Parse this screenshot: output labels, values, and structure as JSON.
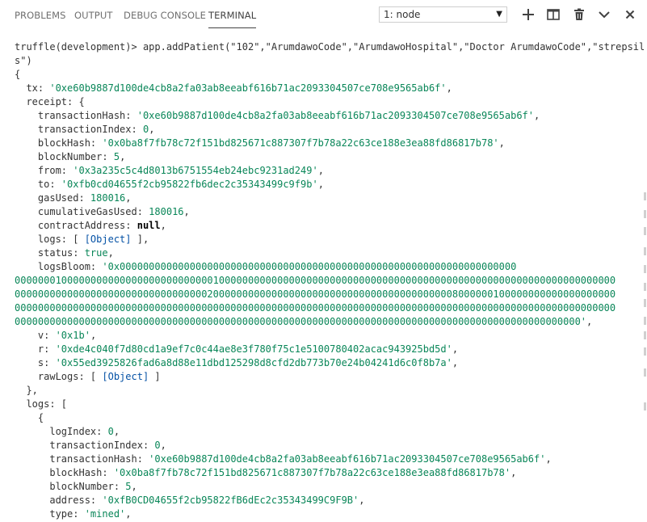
{
  "tabs": [
    {
      "label": "PROBLEMS"
    },
    {
      "label": "OUTPUT"
    },
    {
      "label": "DEBUG CONSOLE"
    },
    {
      "label": "TERMINAL"
    }
  ],
  "terminal_select": {
    "value": "1: node",
    "options": [
      "1: node"
    ]
  },
  "toolbar": {
    "add_icon": "plus-icon",
    "split_icon": "split-pane-icon",
    "delete_icon": "trash-icon",
    "collapse_icon": "chevron-down-icon",
    "close_icon": "close-icon"
  },
  "colors": {
    "string": "#098658",
    "object_link": "#0451a5",
    "text": "#333333"
  },
  "terminal_lines": [
    [
      {
        "t": "truffle(development)> app.addPatient(\"102\",\"ArumdawoCode\",\"ArumdawoHospital\",\"Doctor ArumdawoCode\",\"strepsil"
      }
    ],
    [
      {
        "t": "s\")"
      }
    ],
    [
      {
        "t": "{"
      }
    ],
    [
      {
        "t": "  tx: "
      },
      {
        "t": "'0xe60b9887d100de4cb8a2fa03ab8eeabf616b71ac2093304507ce708e9565ab6f'",
        "c": "s"
      },
      {
        "t": ","
      }
    ],
    [
      {
        "t": "  receipt: {"
      }
    ],
    [
      {
        "t": "    transactionHash: "
      },
      {
        "t": "'0xe60b9887d100de4cb8a2fa03ab8eeabf616b71ac2093304507ce708e9565ab6f'",
        "c": "s"
      },
      {
        "t": ","
      }
    ],
    [
      {
        "t": "    transactionIndex: "
      },
      {
        "t": "0",
        "c": "n"
      },
      {
        "t": ","
      }
    ],
    [
      {
        "t": "    blockHash: "
      },
      {
        "t": "'0x0ba8f7fb78c72f151bd825671c887307f7b78a22c63ce188e3ea88fd86817b78'",
        "c": "s"
      },
      {
        "t": ","
      }
    ],
    [
      {
        "t": "    blockNumber: "
      },
      {
        "t": "5",
        "c": "n"
      },
      {
        "t": ","
      }
    ],
    [
      {
        "t": "    from: "
      },
      {
        "t": "'0x3a235c5c4d8013b6751554eb24ebc9231ad249'",
        "c": "s"
      },
      {
        "t": ","
      }
    ],
    [
      {
        "t": "    to: "
      },
      {
        "t": "'0xfb0cd04655f2cb95822fb6dec2c35343499c9f9b'",
        "c": "s"
      },
      {
        "t": ","
      }
    ],
    [
      {
        "t": "    gasUsed: "
      },
      {
        "t": "180016",
        "c": "n"
      },
      {
        "t": ","
      }
    ],
    [
      {
        "t": "    cumulativeGasUsed: "
      },
      {
        "t": "180016",
        "c": "n"
      },
      {
        "t": ","
      }
    ],
    [
      {
        "t": "    contractAddress: "
      },
      {
        "t": "null",
        "c": "k"
      },
      {
        "t": ","
      }
    ],
    [
      {
        "t": "    logs: [ "
      },
      {
        "t": "[Object]",
        "c": "o"
      },
      {
        "t": " ],"
      }
    ],
    [
      {
        "t": "    status: "
      },
      {
        "t": "true",
        "c": "b"
      },
      {
        "t": ","
      }
    ],
    [
      {
        "t": "    logsBloom: "
      },
      {
        "t": "'0x00000000000000000000000000000000000000000000000000000000000000000000",
        "c": "s"
      }
    ],
    [
      {
        "t": "0000000100000000000000000000000000100000000000000000000000000000000000000000000000000000000000000000000",
        "c": "s"
      }
    ],
    [
      {
        "t": "0000000000000000000000000000000002000000000000000000000000000000000000000008000000100000000000000000000",
        "c": "s"
      }
    ],
    [
      {
        "t": "0000000000000000000000000000000000000000000000000000000000000000000000000000000000000000000000000000000",
        "c": "s"
      }
    ],
    [
      {
        "t": "0000000000000000000000000000000000000000000000000000000000000000000000000000000000000000000000000'",
        "c": "s"
      },
      {
        "t": ","
      }
    ],
    [
      {
        "t": "    v: "
      },
      {
        "t": "'0x1b'",
        "c": "s"
      },
      {
        "t": ","
      }
    ],
    [
      {
        "t": "    r: "
      },
      {
        "t": "'0xde4c040f7d80cd1a9ef7c0c44ae8e3f780f75c1e5100780402acac943925bd5d'",
        "c": "s"
      },
      {
        "t": ","
      }
    ],
    [
      {
        "t": "    s: "
      },
      {
        "t": "'0x55ed3925826fad6a8d88e11dbd125298d8cfd2db773b70e24b04241d6c0f8b7a'",
        "c": "s"
      },
      {
        "t": ","
      }
    ],
    [
      {
        "t": "    rawLogs: [ "
      },
      {
        "t": "[Object]",
        "c": "o"
      },
      {
        "t": " ]"
      }
    ],
    [
      {
        "t": "  },"
      }
    ],
    [
      {
        "t": "  logs: ["
      }
    ],
    [
      {
        "t": "    {"
      }
    ],
    [
      {
        "t": "      logIndex: "
      },
      {
        "t": "0",
        "c": "n"
      },
      {
        "t": ","
      }
    ],
    [
      {
        "t": "      transactionIndex: "
      },
      {
        "t": "0",
        "c": "n"
      },
      {
        "t": ","
      }
    ],
    [
      {
        "t": "      transactionHash: "
      },
      {
        "t": "'0xe60b9887d100de4cb8a2fa03ab8eeabf616b71ac2093304507ce708e9565ab6f'",
        "c": "s"
      },
      {
        "t": ","
      }
    ],
    [
      {
        "t": "      blockHash: "
      },
      {
        "t": "'0x0ba8f7fb78c72f151bd825671c887307f7b78a22c63ce188e3ea88fd86817b78'",
        "c": "s"
      },
      {
        "t": ","
      }
    ],
    [
      {
        "t": "      blockNumber: "
      },
      {
        "t": "5",
        "c": "n"
      },
      {
        "t": ","
      }
    ],
    [
      {
        "t": "      address: "
      },
      {
        "t": "'0xfB0CD04655f2cb95822fB6dEc2c35343499C9F9B'",
        "c": "s"
      },
      {
        "t": ","
      }
    ],
    [
      {
        "t": "      type: "
      },
      {
        "t": "'mined'",
        "c": "s"
      },
      {
        "t": ","
      }
    ]
  ]
}
